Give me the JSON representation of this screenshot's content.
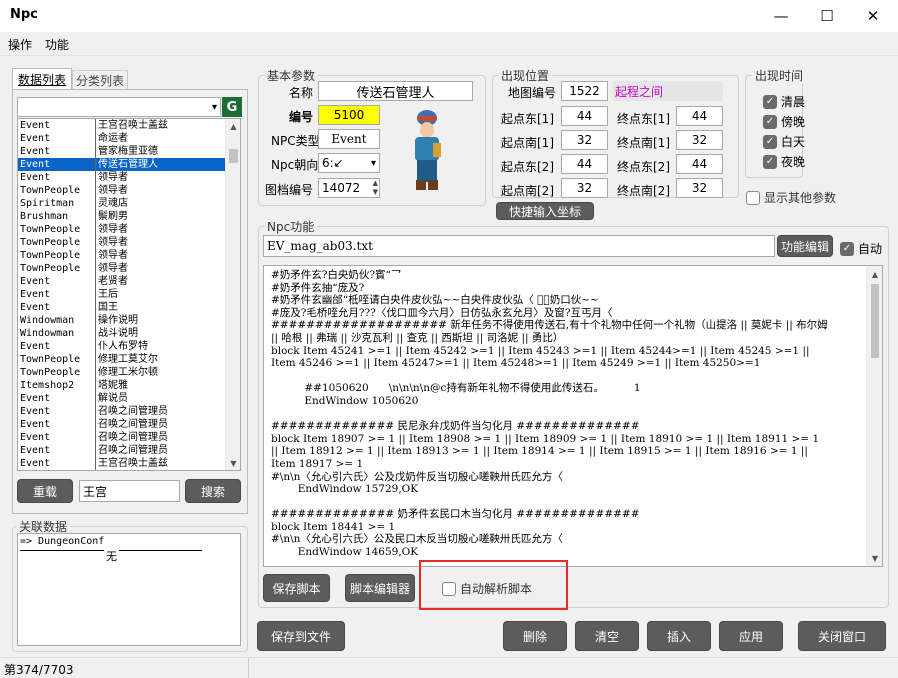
{
  "window": {
    "title": "Npc",
    "minimize": "—",
    "maximize": "☐",
    "close": "✕"
  },
  "menu": [
    "操作",
    "功能"
  ],
  "left_tabs": [
    "数据列表",
    "分类列表"
  ],
  "g_button": "G",
  "list": [
    [
      "Event",
      "王宫召唤士盖兹"
    ],
    [
      "Event",
      "命运者"
    ],
    [
      "Event",
      "管家梅里亚德"
    ],
    [
      "Event",
      "传送石管理人"
    ],
    [
      "Event",
      "领导者"
    ],
    [
      "TownPeople",
      "领导者"
    ],
    [
      "Spiritman",
      "灵魂店"
    ],
    [
      "Brushman",
      "鬃刷男"
    ],
    [
      "TownPeople",
      "领导者"
    ],
    [
      "TownPeople",
      "领导者"
    ],
    [
      "TownPeople",
      "领导者"
    ],
    [
      "TownPeople",
      "领导者"
    ],
    [
      "Event",
      "老贤者"
    ],
    [
      "Event",
      "王后"
    ],
    [
      "Event",
      "国王"
    ],
    [
      "Windowman",
      "操作说明"
    ],
    [
      "Windowman",
      "战斗说明"
    ],
    [
      "Event",
      "仆人布罗特"
    ],
    [
      "TownPeople",
      "修理工莫艾尔"
    ],
    [
      "TownPeople",
      "修理工米尔顿"
    ],
    [
      "Itemshop2",
      "塔妮雅"
    ],
    [
      "Event",
      "解说员"
    ],
    [
      "Event",
      "召唤之间管理员"
    ],
    [
      "Event",
      "召唤之间管理员"
    ],
    [
      "Event",
      "召唤之间管理员"
    ],
    [
      "Event",
      "召唤之间管理员"
    ],
    [
      "Event",
      "王宫召唤士盖兹"
    ]
  ],
  "selected_index": 3,
  "reload_button": "重载",
  "search_value": "王宫",
  "search_button": "搜索",
  "related": {
    "legend": "关联数据",
    "line1": "=> DungeonConf",
    "line2": "无"
  },
  "status_bar": "第374/7703",
  "basic": {
    "legend": "基本参数",
    "name_label": "名称",
    "name_value": "传送石管理人",
    "id_label": "编号",
    "id_value": "5100",
    "type_label": "NPC类型",
    "type_value": "Event",
    "dir_label": "Npc朝向",
    "dir_value": "6:↙",
    "img_label": "图档编号",
    "img_value": "14072"
  },
  "location": {
    "legend": "出现位置",
    "map_label": "地图编号",
    "map_value": "1522",
    "map_name": "起程之间",
    "e1_label": "起点东[1]",
    "e1_value": "44",
    "ee1_label": "终点东[1]",
    "ee1_value": "44",
    "s1_label": "起点南[1]",
    "s1_value": "32",
    "es1_label": "终点南[1]",
    "es1_value": "32",
    "e2_label": "起点东[2]",
    "e2_value": "44",
    "ee2_label": "终点东[2]",
    "ee2_value": "44",
    "s2_label": "起点南[2]",
    "s2_value": "32",
    "es2_label": "终点南[2]",
    "es2_value": "32",
    "quick_button": "快捷输入坐标"
  },
  "time": {
    "legend": "出现时间",
    "items": [
      "清晨",
      "傍晚",
      "白天",
      "夜晚"
    ]
  },
  "show_other": "显示其他参数",
  "npc_func": {
    "legend": "Npc功能",
    "file": "EV_mag_ab03.txt",
    "edit_button": "功能编辑",
    "auto_label": "自动",
    "script": [
      "#奶矛件玄?白央奶伙?賓“乛",
      "#奶矛件玄抽“庞及?",
      "#奶矛件玄幽邰“柢咥请白央件皮伙弘~~白央件皮伙弘〈 ゙〈奶口伙~~",
      "#庞及?毛桥咥允月???〈伐口皿今六月〉日仿弘永玄允月〉及窗?互丐月〈",
      "#################### 新年任务不得使用传送石,有十个礼物中任何一个礼物（山提洛 || 莫妮卡 || 布尔姆",
      "|| 哈根 || 弗瑞 || 沙克瓦利 || 查克 || 西斯坦 || 司洛妮 || 勇比）",
      "block Item 45241 >=1 || Item 45242 >=1 || Item 45243 >=1 || Item 45244>=1 || Item 45245 >=1 ||",
      "Item 45246 >=1 || Item 45247>=1 || Item 45248>=1 || Item 45249 >=1 || Item 45250>=1",
      "",
      "          ##1050620      \\n\\n\\n\\n@c持有新年礼物不得使用此传送石。         1",
      "          EndWindow 1050620",
      "",
      "############## 民尼永弁戊奶件当匀化月 ##############",
      "block Item 18907 >= 1 || Item 18908 >= 1 || Item 18909 >= 1 || Item 18910 >= 1 || Item 18911 >= 1",
      "|| Item 18912 >= 1 || Item 18913 >= 1 || Item 18914 >= 1 || Item 18915 >= 1 || Item 18916 >= 1 ||",
      "Item 18917 >= 1",
      "#\\n\\n〈允心引六氏〉公及戊奶件反当切殷心嗟鞅卅氏匹允方〈",
      "        EndWindow 15729,OK",
      "",
      "############## 奶矛件玄民口木当匀化月 ##############",
      "block Item 18441 >= 1",
      "#\\n\\n〈允心引六氏〉公及民口木反当切殷心嗟鞅卅氏匹允方〈",
      "        EndWindow 14659,OK"
    ],
    "save_script": "保存脚本",
    "script_editor": "脚本编辑器",
    "auto_parse": "自动解析脚本"
  },
  "bottom": {
    "save_file": "保存到文件",
    "delete": "删除",
    "clear": "清空",
    "insert": "插入",
    "apply": "应用",
    "close": "关闭窗口"
  },
  "colors": {
    "selection": "#0a64c8",
    "id_highlight": "#ffff00",
    "map_name": "#cc00cc",
    "annotation": "#e52b2b"
  }
}
